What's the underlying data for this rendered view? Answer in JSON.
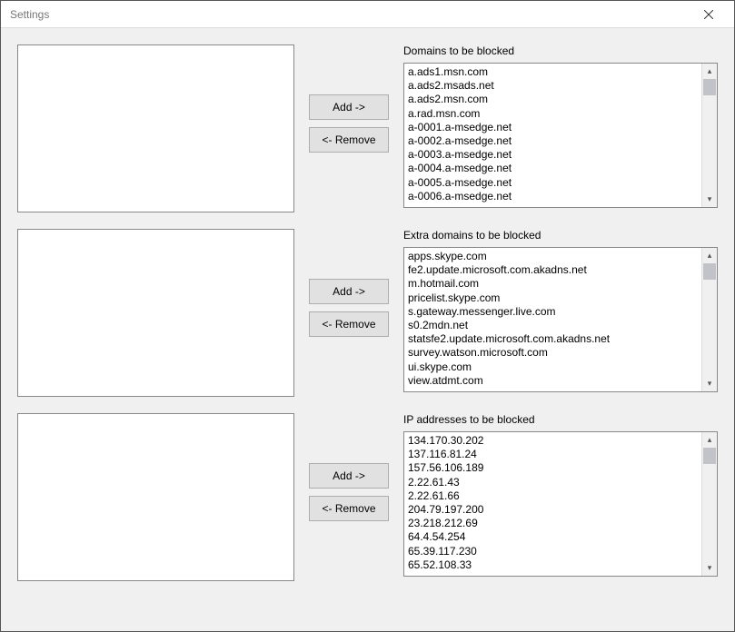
{
  "window": {
    "title": "Settings"
  },
  "buttons": {
    "add": "Add ->",
    "remove": "<- Remove"
  },
  "sections": [
    {
      "label": "Domains to be blocked",
      "items": [
        "a.ads1.msn.com",
        "a.ads2.msads.net",
        "a.ads2.msn.com",
        "a.rad.msn.com",
        "a-0001.a-msedge.net",
        "a-0002.a-msedge.net",
        "a-0003.a-msedge.net",
        "a-0004.a-msedge.net",
        "a-0005.a-msedge.net",
        "a-0006.a-msedge.net"
      ]
    },
    {
      "label": "Extra domains to be blocked",
      "items": [
        "apps.skype.com",
        "fe2.update.microsoft.com.akadns.net",
        "m.hotmail.com",
        "pricelist.skype.com",
        "s.gateway.messenger.live.com",
        "s0.2mdn.net",
        "statsfe2.update.microsoft.com.akadns.net",
        "survey.watson.microsoft.com",
        "ui.skype.com",
        "view.atdmt.com"
      ]
    },
    {
      "label": "IP addresses to be blocked",
      "items": [
        "134.170.30.202",
        "137.116.81.24",
        "157.56.106.189",
        "2.22.61.43",
        "2.22.61.66",
        "204.79.197.200",
        "23.218.212.69",
        "64.4.54.254",
        "65.39.117.230",
        "65.52.108.33"
      ]
    }
  ]
}
